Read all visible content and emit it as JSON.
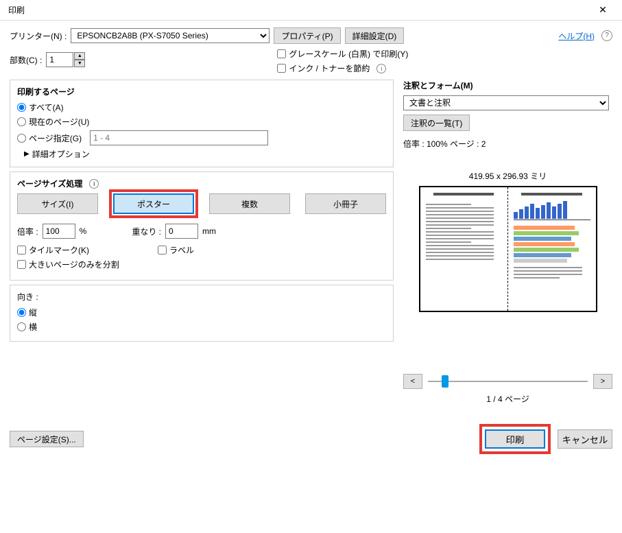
{
  "title": "印刷",
  "printer": {
    "label": "プリンター(N) :",
    "selected": "EPSONCB2A8B (PX-S7050 Series)",
    "btn_properties": "プロパティ(P)",
    "btn_advanced": "詳細設定(D)"
  },
  "help": {
    "label": "ヘルプ(H)"
  },
  "copies": {
    "label": "部数(C) :",
    "value": "1"
  },
  "grayscale": {
    "label": "グレースケール (白黒) で印刷(Y)"
  },
  "savetoner": {
    "label": "インク / トナーを節約"
  },
  "pages": {
    "title": "印刷するページ",
    "all": "すべて(A)",
    "current": "現在のページ(U)",
    "range_label": "ページ指定(G)",
    "range_placeholder": "1 - 4",
    "detail": "詳細オプション"
  },
  "sizegroup": {
    "title": "ページサイズ処理",
    "size": "サイズ(I)",
    "poster": "ポスター",
    "multiple": "複数",
    "booklet": "小冊子"
  },
  "scale": {
    "label": "倍率 :",
    "value": "100",
    "pct": "%",
    "overlap_label": "重なり :",
    "overlap_value": "0",
    "mm": "mm"
  },
  "tilemark": "タイルマーク(K)",
  "labels_chk": "ラベル",
  "bigonly": "大きいページのみを分割",
  "orient": {
    "title": "向き :",
    "v": "縦",
    "h": "横"
  },
  "comments": {
    "title": "注釈とフォーム(M)",
    "selected": "文書と注釈",
    "btn_list": "注釈の一覧(T)"
  },
  "preview": {
    "info": "倍率 : 100% ページ : 2",
    "dims": "419.95 x 296.93 ミリ",
    "nav_prev": "<",
    "nav_next": ">",
    "page_info": "1 / 4 ページ"
  },
  "footer": {
    "page_setup": "ページ設定(S)...",
    "print": "印刷",
    "cancel": "キャンセル"
  }
}
